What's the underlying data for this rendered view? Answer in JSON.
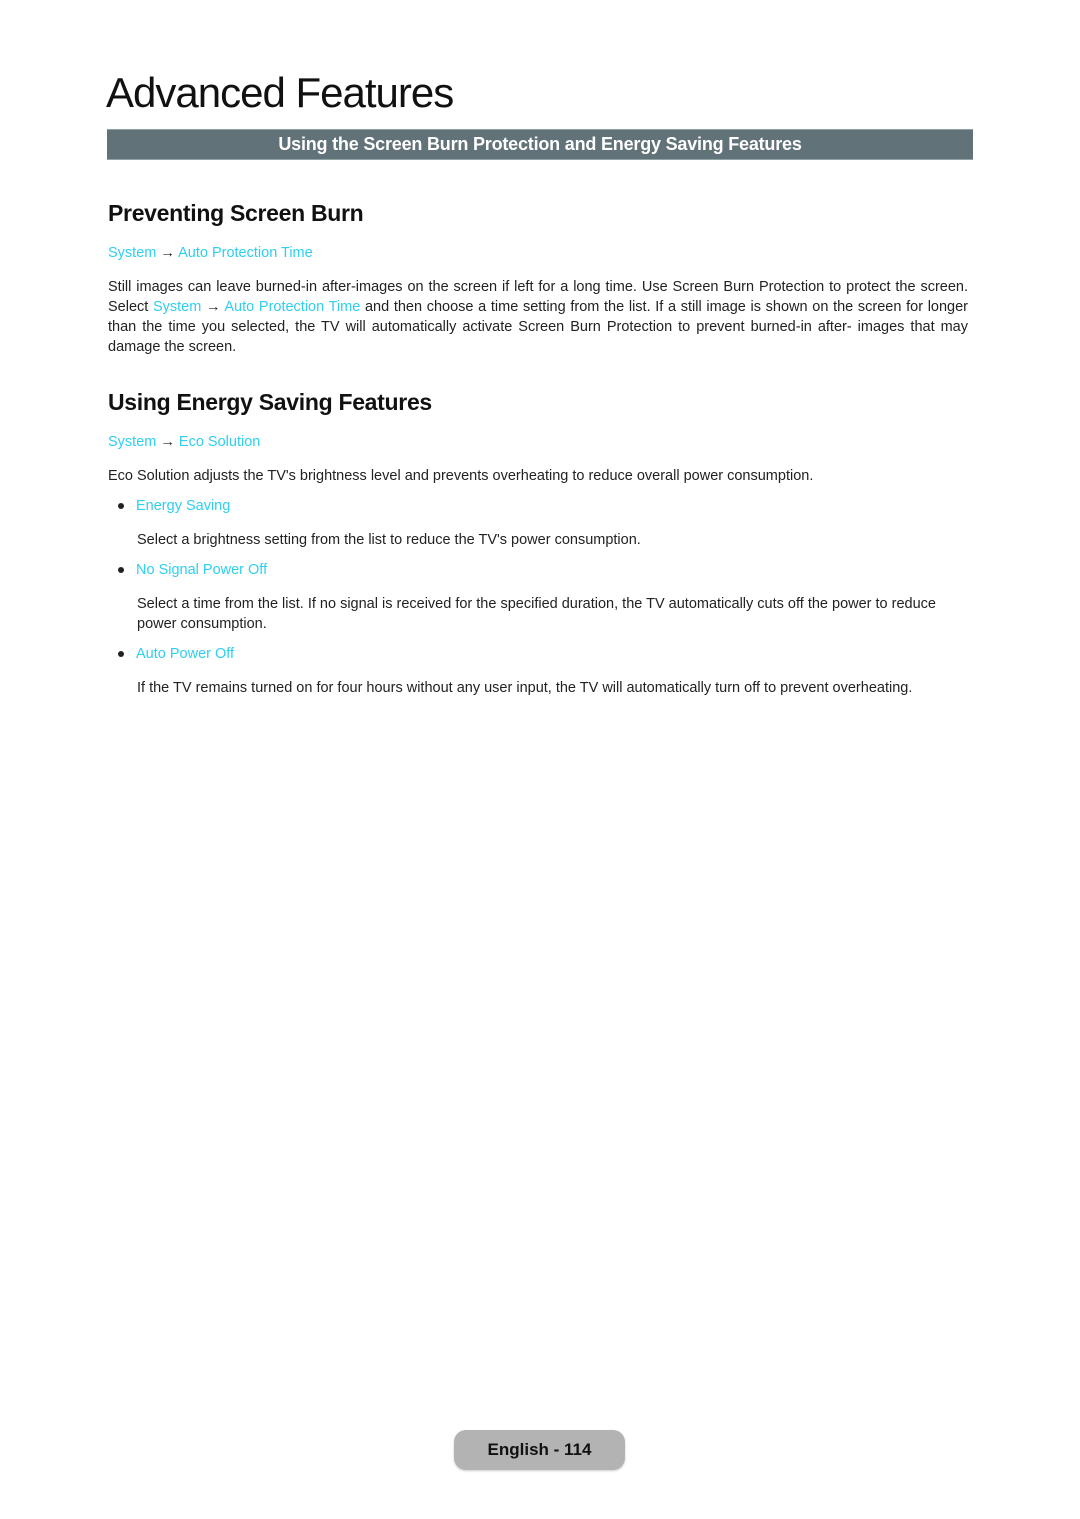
{
  "page": {
    "title": "Advanced Features",
    "banner": "Using the Screen Burn Protection and Energy Saving Features",
    "footer": "English - 114"
  },
  "sections": [
    {
      "heading": "Preventing Screen Burn",
      "path": {
        "parent": "System",
        "arrow": "→",
        "child": "Auto Protection Time"
      },
      "paragraph": {
        "before": "Still images can leave burned-in after-images on the screen if left for a long time. Use Screen Burn Protection to protect the screen. Select ",
        "link1": "System",
        "arrow": " → ",
        "link2": "Auto Protection Time",
        "after": " and then choose a time setting from the list. If a still image is shown on the screen for longer than the time you selected, the TV will automatically activate Screen Burn Protection to prevent burned-in after- images that may damage the screen."
      }
    },
    {
      "heading": "Using Energy Saving Features",
      "path": {
        "parent": "System",
        "arrow": "→",
        "child": "Eco Solution"
      },
      "paragraph": "Eco Solution adjusts the TV's brightness level and prevents overheating to reduce overall power consumption.",
      "items": [
        {
          "label": "Energy Saving",
          "desc": "Select a brightness setting from the list to reduce the TV's power consumption."
        },
        {
          "label": "No Signal Power Off",
          "desc": "Select a time from the list. If no signal is received for the specified duration, the TV automatically cuts off the power to reduce power consumption."
        },
        {
          "label": "Auto Power Off",
          "desc": "If the TV remains turned on for four hours without any user input, the TV will automatically turn off to prevent overheating."
        }
      ]
    }
  ],
  "colors": {
    "link": "#2ecfef",
    "banner_bg": "#617278",
    "footer_bg": "#b3b3b3"
  }
}
